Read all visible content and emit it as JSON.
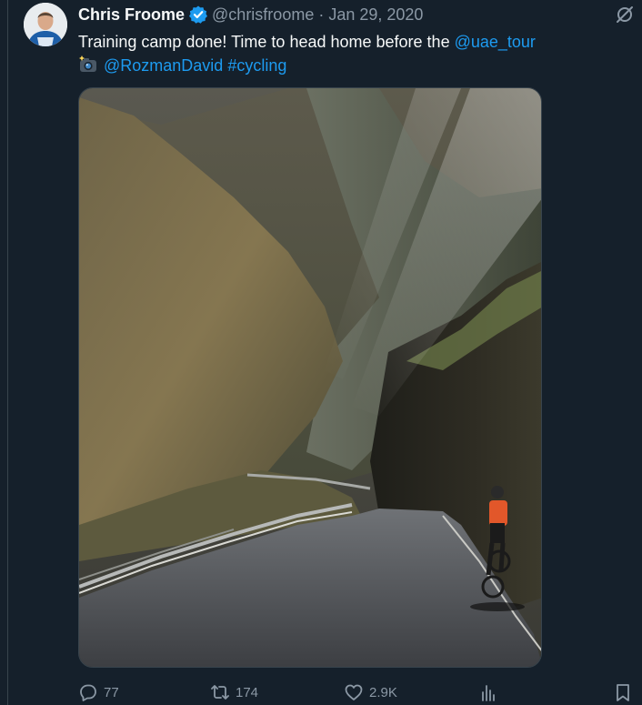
{
  "tweet": {
    "display_name": "Chris Froome",
    "handle": "@chrisfroome",
    "separator": "·",
    "date": "Jan 29, 2020",
    "text_main": "Training camp done! Time to head home before the ",
    "mention_uae": "@uae_tour",
    "mention_photographer": "@RozmanDavid",
    "hashtag": "#cycling"
  },
  "actions": {
    "replies": "77",
    "reposts": "174",
    "likes": "2.9K"
  },
  "colors": {
    "background": "#15202b",
    "text": "#f7f9f9",
    "muted": "#8b98a5",
    "link": "#1d9bf0",
    "verified": "#1d9bf0"
  },
  "icons": [
    "verified-badge-icon",
    "grok-icon",
    "camera-icon",
    "reply-icon",
    "repost-icon",
    "like-icon",
    "views-icon",
    "bookmark-icon"
  ]
}
